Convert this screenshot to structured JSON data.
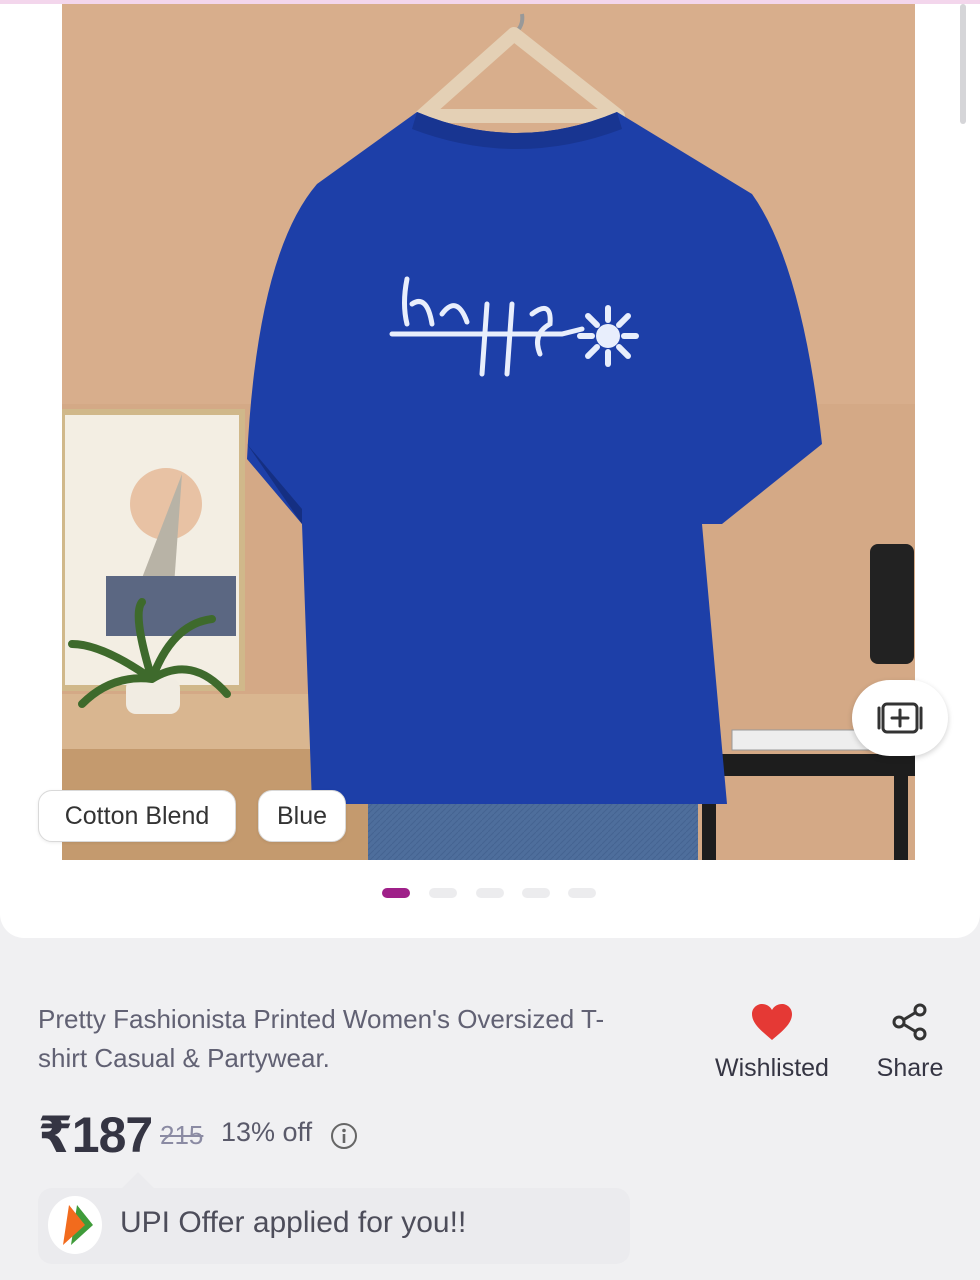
{
  "product": {
    "image_alt": "Blue oversized T-shirt with happy print on hanger",
    "print_text": "happy",
    "attributes": [
      "Cotton Blend",
      "Blue"
    ],
    "title": "Pretty Fashionista Printed Women's Oversized T-shirt Casual & Partywear.",
    "price": "₹187",
    "mrp": "215",
    "discount": "13% off"
  },
  "gallery": {
    "total_images": 5,
    "active_index": 0
  },
  "actions": {
    "wishlist_label": "Wishlisted",
    "share_label": "Share"
  },
  "offer": {
    "text": "UPI Offer applied for you!!"
  },
  "colors": {
    "accent": "#9f2089",
    "heart": "#e53935",
    "shirt": "#1d3fa8"
  }
}
